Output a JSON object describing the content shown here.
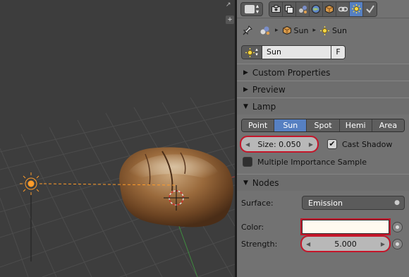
{
  "viewport": {
    "corner_text": "↗",
    "plus_text": "+"
  },
  "header": {
    "editor_type_icon": "properties-editor-icon",
    "context_tabs": [
      {
        "name": "render-tab",
        "icon": "camera-icon",
        "color": "#3b3b3b",
        "active": false
      },
      {
        "name": "render-layers-tab",
        "icon": "layers-icon",
        "color": "#c9c9c9",
        "active": false
      },
      {
        "name": "scene-tab",
        "icon": "scene-icon",
        "color": "#7a8ec9",
        "active": false
      },
      {
        "name": "world-tab",
        "icon": "world-icon",
        "color": "#5f86c4",
        "active": false
      },
      {
        "name": "object-tab",
        "icon": "cube-icon",
        "color": "#d89a4a",
        "active": false
      },
      {
        "name": "constraints-tab",
        "icon": "link-icon",
        "color": "#d9d9d9",
        "active": false
      },
      {
        "name": "data-tab",
        "icon": "sun-icon",
        "color": "#f5d94a",
        "active": true
      },
      {
        "name": "material-tab",
        "icon": "check-icon",
        "color": "#cfcfcf",
        "active": false
      }
    ]
  },
  "breadcrumb": {
    "items": [
      "Sun",
      "Sun"
    ]
  },
  "datablock": {
    "name": "Sun",
    "fake_user": "F"
  },
  "sections": {
    "custom_properties": "Custom Properties",
    "preview": "Preview",
    "lamp": "Lamp",
    "nodes": "Nodes"
  },
  "lamp": {
    "types": [
      "Point",
      "Sun",
      "Spot",
      "Hemi",
      "Area"
    ],
    "active_type": "Sun",
    "size_label": "Size: 0.050",
    "cast_shadow": "Cast Shadow",
    "multiple_importance": "Multiple Importance Sample"
  },
  "nodes": {
    "surface_label": "Surface:",
    "surface_value": "Emission",
    "color_label": "Color:",
    "color_value": "#fffaf0",
    "strength_label": "Strength:",
    "strength_value": "5.000"
  },
  "colors": {
    "highlight": "#c4162a",
    "active": "#5680c2",
    "panel": "#727272"
  }
}
